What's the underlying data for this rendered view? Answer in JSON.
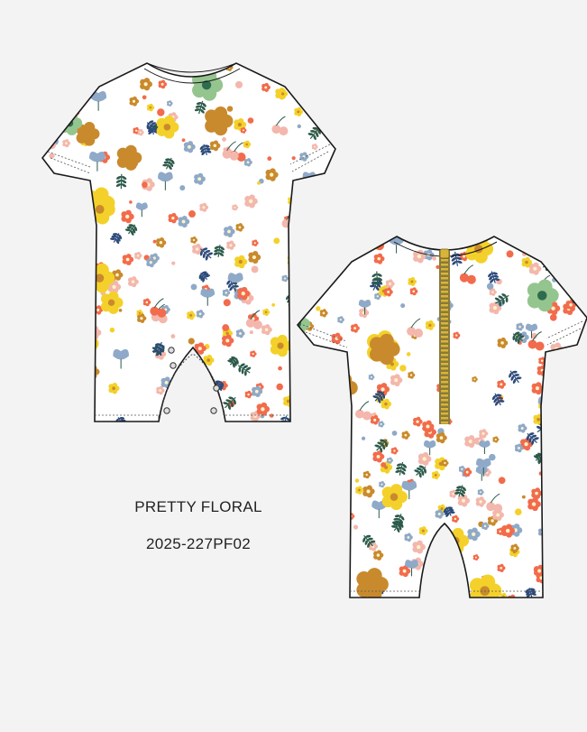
{
  "design": {
    "name": "PRETTY FLORAL",
    "code": "2025-227PF02"
  },
  "garments": [
    {
      "view": "front",
      "features": [
        "crew-neck",
        "short-sleeves",
        "snap-crotch"
      ]
    },
    {
      "view": "back",
      "features": [
        "crew-neck",
        "short-sleeves",
        "center-back-zipper"
      ]
    }
  ],
  "print": {
    "background": "#ffffff",
    "palette": {
      "yellow": "#f4d12a",
      "coral": "#f26b4c",
      "mustard": "#c98a2d",
      "sage": "#95c58e",
      "blue": "#8fa9c8",
      "pink": "#f3b7ad",
      "navy": "#2c4a7a",
      "leaf": "#2c5a4a",
      "zipper": "#d8b53a",
      "outline": "#1a1a1a"
    }
  }
}
